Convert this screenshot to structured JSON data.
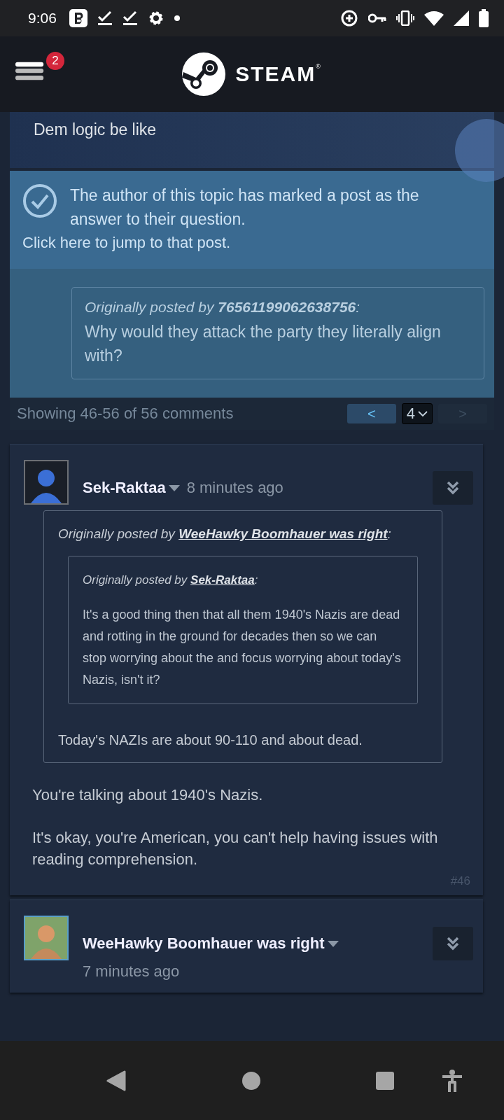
{
  "status_bar": {
    "time": "9:06"
  },
  "header": {
    "menu_badge": "2",
    "logo_text": "STEAM$^{®}$"
  },
  "topic": {
    "body": "Dem logic be like"
  },
  "answer_notice": {
    "text": "The author of this topic has marked a post as the answer to their question.",
    "link": "Click here to jump to that post."
  },
  "answer_quote": {
    "label": "Originally posted by",
    "author": "76561199062638756",
    "suffix": ":",
    "text": "Why would they attack the party they literally align with?"
  },
  "pagination": {
    "summary": "Showing 46-56 of 56 comments",
    "prev": {
      "label": "<",
      "disabled": false
    },
    "page": "4",
    "next": {
      "label": ">",
      "disabled": true
    }
  },
  "comments": [
    {
      "author": "Sek-Raktaa",
      "time": "8 minutes ago",
      "quote": {
        "label": "Originally posted by",
        "author": "WeeHawky Boomhauer was right",
        "suffix": ":",
        "nested": {
          "label": "Originally posted by",
          "author": "Sek-Raktaa",
          "suffix": ":",
          "text": "It's a good thing then that all them 1940's Nazis are dead and rotting in the ground for decades then so we can stop worrying about the and focus worrying about today's Nazis, isn't it?"
        },
        "text": "Today's NAZIs are about 90-110 and about dead."
      },
      "body": [
        "You're talking about 1940's Nazis.",
        "It's okay, you're American, you can't help having issues with reading comprehension."
      ],
      "number": "#46"
    },
    {
      "author": "WeeHawky Boomhauer was right",
      "time": "7 minutes ago"
    }
  ]
}
